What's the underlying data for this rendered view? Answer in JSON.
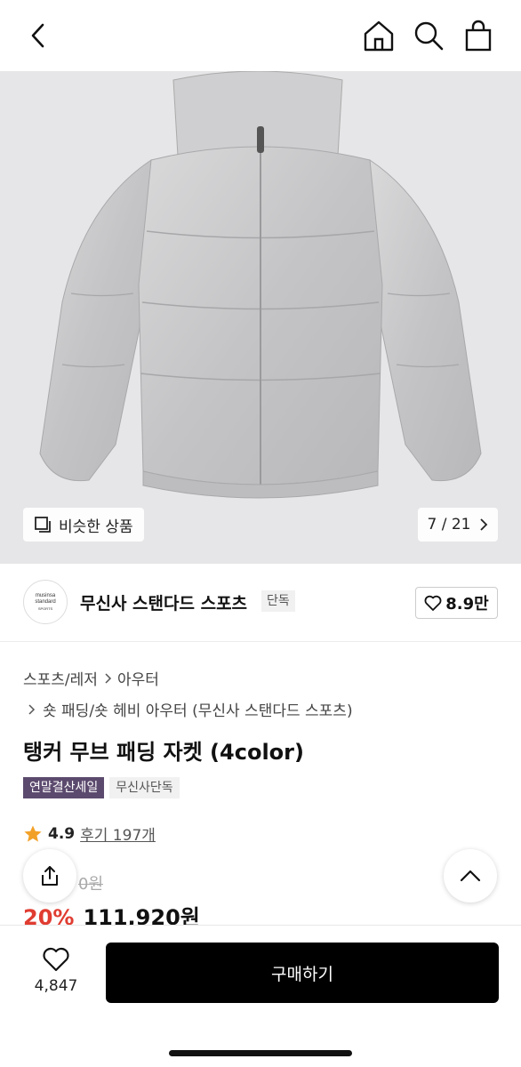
{
  "nav": {
    "back_icon": "chevron-left-icon",
    "home_icon": "home-icon",
    "search_icon": "search-icon",
    "cart_icon": "shopping-bag-icon"
  },
  "hero": {
    "similar_label": "비슷한 상품",
    "counter_current": "7",
    "counter_total": "21",
    "counter_text": "7 / 21",
    "background_color": "#e6e6e8"
  },
  "brand": {
    "logo_line1": "musinsa",
    "logo_line2": "standard",
    "logo_line3": "SPORTS",
    "name": "무신사 스탠다드 스포츠",
    "tag": "단독",
    "like_count": "8.9만"
  },
  "breadcrumb": {
    "level1": "스포츠/레저",
    "level2": "아우터",
    "level3": "숏 패딩/숏 헤비 아우터 (무신사 스탠다드 스포츠)"
  },
  "product": {
    "title": "탱커 무브 패딩 자켓 (4color)",
    "badges": [
      "연말결산세일",
      "무신사단독"
    ],
    "rating": "4.9",
    "reviews": "후기 197개",
    "original_price_visible": "0원",
    "discount": "20%",
    "sale_price": "111,920원"
  },
  "bottom": {
    "wish_count": "4,847",
    "buy_label": "구매하기"
  },
  "colors": {
    "accent_red": "#e03c31",
    "sale_badge": "#5c4a6e",
    "star": "#f2a128",
    "buy_button": "#000000"
  }
}
